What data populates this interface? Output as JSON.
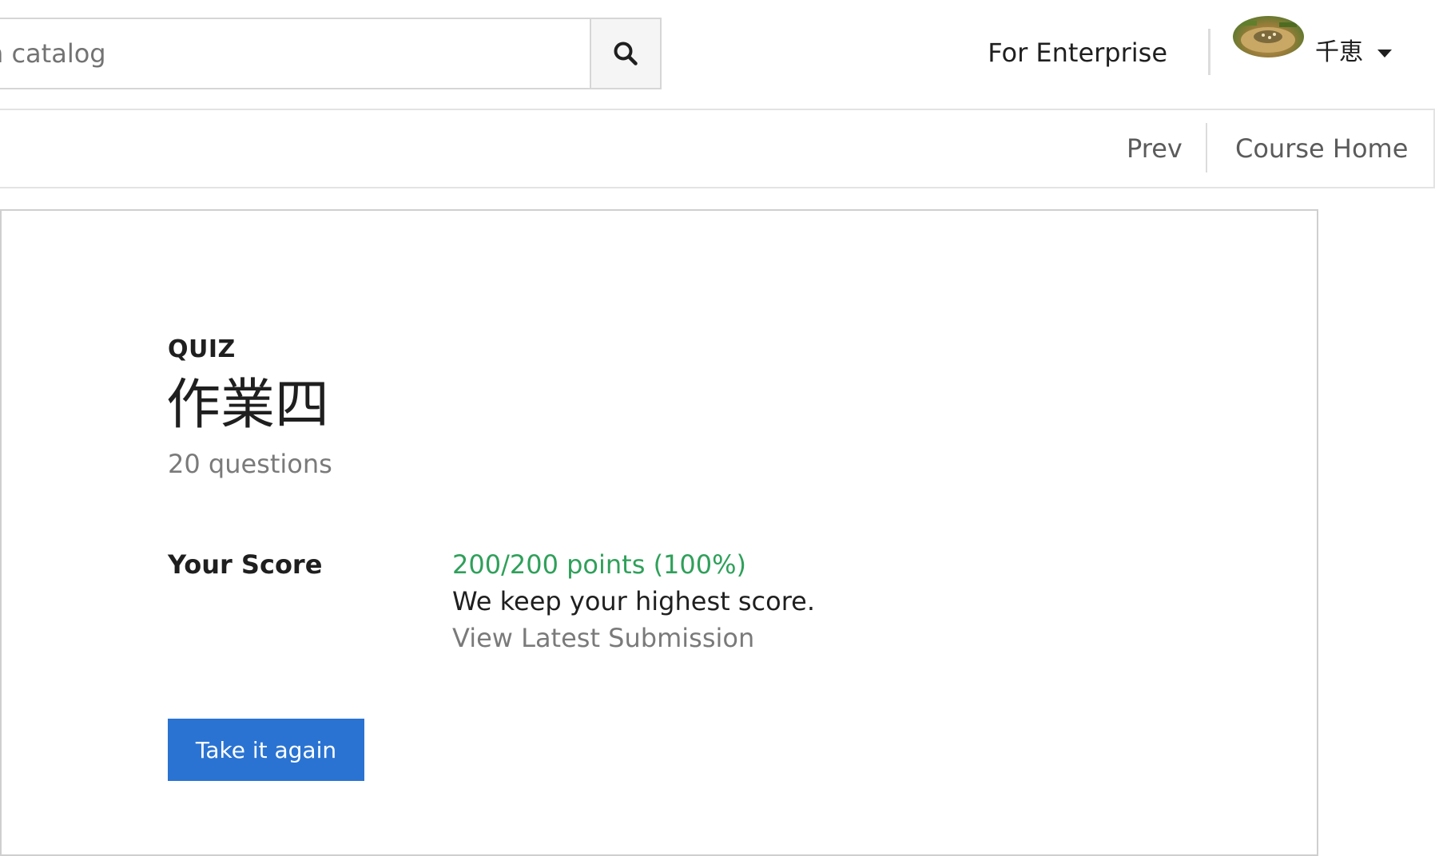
{
  "header": {
    "search": {
      "placeholder": "n catalog",
      "icon": "search-icon"
    },
    "enterprise_label": "For Enterprise",
    "user": {
      "name": "千恵",
      "avatar_icon": "avatar",
      "menu_icon": "caret-down-icon"
    }
  },
  "nav": {
    "prev_label": "Prev",
    "course_home_label": "Course Home"
  },
  "quiz": {
    "type_label": "QUIZ",
    "title": "作業四",
    "question_count": "20 questions",
    "score_label": "Your Score",
    "score_value": "200/200 points (100%)",
    "score_note": "We keep your highest score.",
    "view_submission_label": "View Latest Submission",
    "retake_label": "Take it again"
  },
  "colors": {
    "score_green": "#2fa05a",
    "button_blue": "#2a73d2"
  }
}
